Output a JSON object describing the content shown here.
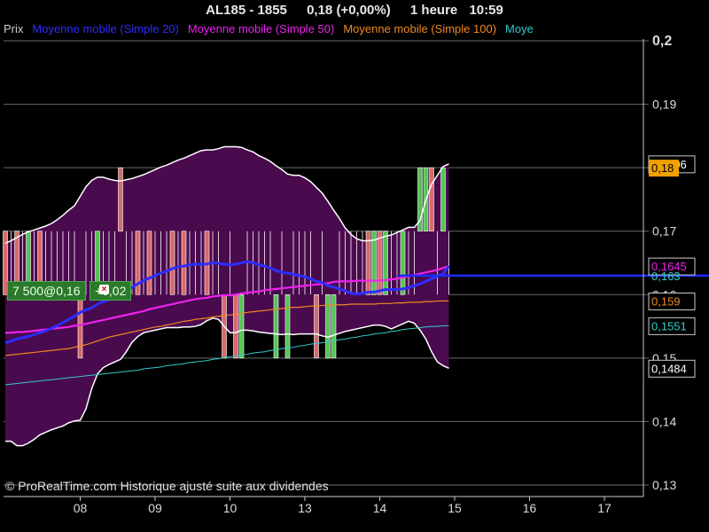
{
  "header": {
    "symbol": "AL185 - 1855",
    "price_change": "0,18 (+0,00%)",
    "timeframe": "1 heure",
    "time": "10:59"
  },
  "legend": [
    {
      "label": "Prix",
      "color": "#cccccc"
    },
    {
      "label": "Moyenne mobile (Simple 20)",
      "color": "#2d2dff"
    },
    {
      "label": "Moyenne mobile (Simple 50)",
      "color": "#ee22ee"
    },
    {
      "label": "Moyenne mobile (Simple 100)",
      "color": "#ee8822"
    },
    {
      "label": "Moye",
      "color": "#33cccc"
    }
  ],
  "watermark": "© ProRealTime.com Historique ajusté suite aux dividendes",
  "position_badge": {
    "label": "7 500@0,16",
    "pnl": "+0,02"
  },
  "colors": {
    "band_fill": "#4a0a4e",
    "up_candle": "#55c455",
    "down_candle": "#d86a6a",
    "grid": "#6a6a6a",
    "current_price_line": "#1a2cff"
  },
  "chart_data": {
    "type": "line",
    "title": "AL185 - 1855",
    "xlabel": "",
    "ylabel": "",
    "ylim": [
      0.13,
      0.2
    ],
    "x_ticks": [
      "08",
      "09",
      "10",
      "13",
      "14",
      "15",
      "16",
      "17"
    ],
    "y_ticks": [
      "0,13",
      "0,14",
      "0,15",
      "0,16",
      "0,17",
      "0,18",
      "0,19",
      "0,2"
    ],
    "grid": true,
    "current_price": 0.163,
    "value_labels": [
      {
        "text": "0,1806",
        "color": "#ffffff"
      },
      {
        "text": "0,18",
        "color": "#f0a000"
      },
      {
        "text": "0,1645",
        "color": "#ee22ee"
      },
      {
        "text": "0,163",
        "color": "#33cccc"
      },
      {
        "text": "0,159",
        "color": "#ee8822"
      },
      {
        "text": "0,1551",
        "color": "#33cccc"
      },
      {
        "text": "0,1484",
        "color": "#ffffff"
      }
    ],
    "x_points": 78,
    "bollinger_upper": [
      0.1681,
      0.1685,
      0.169,
      0.1695,
      0.1699,
      0.1702,
      0.1705,
      0.1708,
      0.1712,
      0.1718,
      0.1725,
      0.1733,
      0.174,
      0.1755,
      0.177,
      0.178,
      0.1785,
      0.1785,
      0.1782,
      0.178,
      0.1779,
      0.1781,
      0.1783,
      0.1786,
      0.1789,
      0.1793,
      0.1797,
      0.1801,
      0.1804,
      0.1808,
      0.1812,
      0.1815,
      0.1819,
      0.1823,
      0.1827,
      0.1828,
      0.1828,
      0.183,
      0.1833,
      0.1833,
      0.1833,
      0.1832,
      0.1828,
      0.1825,
      0.1819,
      0.1815,
      0.181,
      0.1803,
      0.1797,
      0.179,
      0.1788,
      0.1788,
      0.1784,
      0.1778,
      0.1769,
      0.176,
      0.1747,
      0.1733,
      0.172,
      0.1705,
      0.1695,
      0.1688,
      0.1685,
      0.1685,
      0.1686,
      0.1689,
      0.1692,
      0.1694,
      0.1698,
      0.1702,
      0.1706,
      0.1706,
      0.1717,
      0.1749,
      0.1774,
      0.1788,
      0.1802,
      0.1806
    ],
    "bollinger_lower": [
      0.1369,
      0.1369,
      0.1362,
      0.1362,
      0.1366,
      0.1372,
      0.1379,
      0.1383,
      0.1387,
      0.139,
      0.1393,
      0.1398,
      0.1401,
      0.1402,
      0.142,
      0.1452,
      0.1475,
      0.1485,
      0.149,
      0.1494,
      0.1498,
      0.151,
      0.1525,
      0.1534,
      0.154,
      0.1542,
      0.1544,
      0.1546,
      0.1548,
      0.1548,
      0.1548,
      0.1549,
      0.1549,
      0.155,
      0.1553,
      0.1559,
      0.1563,
      0.1561,
      0.155,
      0.154,
      0.154,
      0.1544,
      0.1544,
      0.1543,
      0.1541,
      0.154,
      0.1539,
      0.1538,
      0.1537,
      0.1538,
      0.1537,
      0.1538,
      0.1538,
      0.1538,
      0.1538,
      0.1535,
      0.1533,
      0.1536,
      0.1539,
      0.1542,
      0.1544,
      0.1546,
      0.1548,
      0.155,
      0.1552,
      0.1552,
      0.155,
      0.1546,
      0.155,
      0.1554,
      0.1558,
      0.1555,
      0.1544,
      0.153,
      0.151,
      0.1494,
      0.1488,
      0.1484
    ],
    "ma20": [
      0.1524,
      0.1527,
      0.153,
      0.1532,
      0.1534,
      0.1537,
      0.154,
      0.1543,
      0.1547,
      0.1551,
      0.1556,
      0.1561,
      0.1566,
      0.1572,
      0.1576,
      0.1579,
      0.1585,
      0.1589,
      0.1592,
      0.1596,
      0.1601,
      0.1605,
      0.1611,
      0.1617,
      0.1622,
      0.1626,
      0.163,
      0.1634,
      0.1637,
      0.1641,
      0.1644,
      0.1645,
      0.1647,
      0.1648,
      0.1648,
      0.1648,
      0.1651,
      0.1649,
      0.1648,
      0.1647,
      0.1648,
      0.165,
      0.1652,
      0.165,
      0.1647,
      0.1645,
      0.1642,
      0.1638,
      0.1635,
      0.1634,
      0.1632,
      0.163,
      0.1628,
      0.1625,
      0.1621,
      0.1619,
      0.1614,
      0.1612,
      0.1609,
      0.1606,
      0.1602,
      0.1601,
      0.1602,
      0.1604,
      0.1604,
      0.1606,
      0.1608,
      0.1608,
      0.1608,
      0.1609,
      0.1611,
      0.1614,
      0.1617,
      0.1621,
      0.1625,
      0.1629,
      0.1633,
      0.1645
    ],
    "ma50": [
      0.154,
      0.154,
      0.1541,
      0.1541,
      0.1542,
      0.1543,
      0.1544,
      0.1545,
      0.1546,
      0.1547,
      0.1548,
      0.1549,
      0.1551,
      0.1552,
      0.1554,
      0.1556,
      0.1558,
      0.156,
      0.1562,
      0.1564,
      0.1566,
      0.1568,
      0.157,
      0.1572,
      0.1574,
      0.1577,
      0.1579,
      0.1581,
      0.1583,
      0.1585,
      0.1587,
      0.1589,
      0.1591,
      0.1593,
      0.1594,
      0.1595,
      0.1597,
      0.1598,
      0.1599,
      0.1599,
      0.16,
      0.1602,
      0.1603,
      0.1604,
      0.1605,
      0.1607,
      0.1608,
      0.1609,
      0.161,
      0.1611,
      0.1612,
      0.1613,
      0.1614,
      0.1615,
      0.1616,
      0.1617,
      0.1618,
      0.162,
      0.1621,
      0.1621,
      0.1621,
      0.1622,
      0.1622,
      0.1622,
      0.1622,
      0.1622,
      0.1623,
      0.1624,
      0.1625,
      0.1627,
      0.1629,
      0.1631,
      0.1633,
      0.1635,
      0.1637,
      0.1639,
      0.1642,
      0.1645
    ],
    "ma100": [
      0.1504,
      0.1505,
      0.1506,
      0.1507,
      0.1508,
      0.1509,
      0.151,
      0.1511,
      0.1512,
      0.1513,
      0.1514,
      0.1515,
      0.1517,
      0.1519,
      0.1521,
      0.1524,
      0.1527,
      0.153,
      0.1533,
      0.1535,
      0.1537,
      0.1539,
      0.1541,
      0.1543,
      0.1545,
      0.1547,
      0.1549,
      0.155,
      0.1552,
      0.1554,
      0.1556,
      0.1558,
      0.1559,
      0.1561,
      0.1562,
      0.1563,
      0.1565,
      0.1566,
      0.1567,
      0.1568,
      0.1569,
      0.157,
      0.1572,
      0.1573,
      0.1574,
      0.1575,
      0.1576,
      0.1577,
      0.1578,
      0.1579,
      0.158,
      0.158,
      0.1581,
      0.1582,
      0.1582,
      0.1583,
      0.1583,
      0.1584,
      0.1584,
      0.1584,
      0.1585,
      0.1585,
      0.1585,
      0.1585,
      0.1585,
      0.1586,
      0.1586,
      0.1586,
      0.1587,
      0.1587,
      0.1588,
      0.1588,
      0.1588,
      0.1589,
      0.1589,
      0.159,
      0.159,
      0.159
    ],
    "ma200": [
      0.1458,
      0.1459,
      0.146,
      0.1461,
      0.1462,
      0.1463,
      0.1464,
      0.1465,
      0.1466,
      0.1467,
      0.1468,
      0.1469,
      0.147,
      0.1471,
      0.1472,
      0.1473,
      0.1474,
      0.1475,
      0.1476,
      0.1477,
      0.1478,
      0.1479,
      0.148,
      0.1481,
      0.1483,
      0.1484,
      0.1485,
      0.1486,
      0.1488,
      0.1489,
      0.149,
      0.1491,
      0.1493,
      0.1494,
      0.1495,
      0.1496,
      0.1498,
      0.1499,
      0.1501,
      0.1502,
      0.1503,
      0.1505,
      0.1506,
      0.1508,
      0.1509,
      0.151,
      0.1512,
      0.1513,
      0.1515,
      0.1516,
      0.1517,
      0.1519,
      0.152,
      0.1522,
      0.1523,
      0.1524,
      0.1526,
      0.1527,
      0.1529,
      0.153,
      0.1532,
      0.1533,
      0.1535,
      0.1536,
      0.1538,
      0.1539,
      0.154,
      0.1542,
      0.1543,
      0.1545,
      0.1546,
      0.1547,
      0.1548,
      0.1549,
      0.155,
      0.155,
      0.1551,
      0.1551
    ],
    "candles": [
      {
        "i": 0,
        "open": 0.17,
        "close": 0.16,
        "dir": "down"
      },
      {
        "i": 2,
        "open": 0.17,
        "close": 0.16,
        "dir": "down"
      },
      {
        "i": 4,
        "open": 0.16,
        "close": 0.17,
        "dir": "up"
      },
      {
        "i": 6,
        "open": 0.17,
        "close": 0.16,
        "dir": "down"
      },
      {
        "i": 13,
        "open": 0.16,
        "close": 0.15,
        "dir": "down"
      },
      {
        "i": 16,
        "open": 0.16,
        "close": 0.17,
        "dir": "up"
      },
      {
        "i": 20,
        "open": 0.18,
        "close": 0.17,
        "dir": "down"
      },
      {
        "i": 23,
        "open": 0.17,
        "close": 0.16,
        "dir": "down"
      },
      {
        "i": 25,
        "open": 0.17,
        "close": 0.16,
        "dir": "down"
      },
      {
        "i": 29,
        "open": 0.17,
        "close": 0.16,
        "dir": "down"
      },
      {
        "i": 31,
        "open": 0.17,
        "close": 0.16,
        "dir": "down"
      },
      {
        "i": 35,
        "open": 0.17,
        "close": 0.16,
        "dir": "down"
      },
      {
        "i": 38,
        "open": 0.16,
        "close": 0.15,
        "dir": "down"
      },
      {
        "i": 40,
        "open": 0.16,
        "close": 0.15,
        "dir": "down"
      },
      {
        "i": 41,
        "open": 0.15,
        "close": 0.16,
        "dir": "up"
      },
      {
        "i": 47,
        "open": 0.15,
        "close": 0.16,
        "dir": "up"
      },
      {
        "i": 49,
        "open": 0.15,
        "close": 0.16,
        "dir": "up"
      },
      {
        "i": 54,
        "open": 0.16,
        "close": 0.15,
        "dir": "down"
      },
      {
        "i": 56,
        "open": 0.15,
        "close": 0.16,
        "dir": "up"
      },
      {
        "i": 57,
        "open": 0.15,
        "close": 0.16,
        "dir": "up"
      },
      {
        "i": 63,
        "open": 0.17,
        "close": 0.16,
        "dir": "down"
      },
      {
        "i": 64,
        "open": 0.16,
        "close": 0.17,
        "dir": "up"
      },
      {
        "i": 65,
        "open": 0.17,
        "close": 0.16,
        "dir": "down"
      },
      {
        "i": 66,
        "open": 0.16,
        "close": 0.17,
        "dir": "up"
      },
      {
        "i": 69,
        "open": 0.16,
        "close": 0.17,
        "dir": "up"
      },
      {
        "i": 72,
        "open": 0.17,
        "close": 0.18,
        "dir": "up"
      },
      {
        "i": 73,
        "open": 0.17,
        "close": 0.18,
        "dir": "up"
      },
      {
        "i": 74,
        "open": 0.18,
        "close": 0.17,
        "dir": "down"
      },
      {
        "i": 76,
        "open": 0.17,
        "close": 0.18,
        "dir": "up"
      }
    ],
    "dojis": [
      1,
      3,
      5,
      7,
      8,
      9,
      10,
      11,
      12,
      14,
      15,
      17,
      18,
      19,
      21,
      22,
      24,
      26,
      27,
      28,
      30,
      32,
      33,
      34,
      36,
      37,
      39,
      42,
      43,
      44,
      45,
      46,
      48,
      50,
      51,
      52,
      53,
      55,
      58,
      59,
      60,
      61,
      62,
      67,
      68,
      70,
      71,
      75,
      77
    ]
  }
}
